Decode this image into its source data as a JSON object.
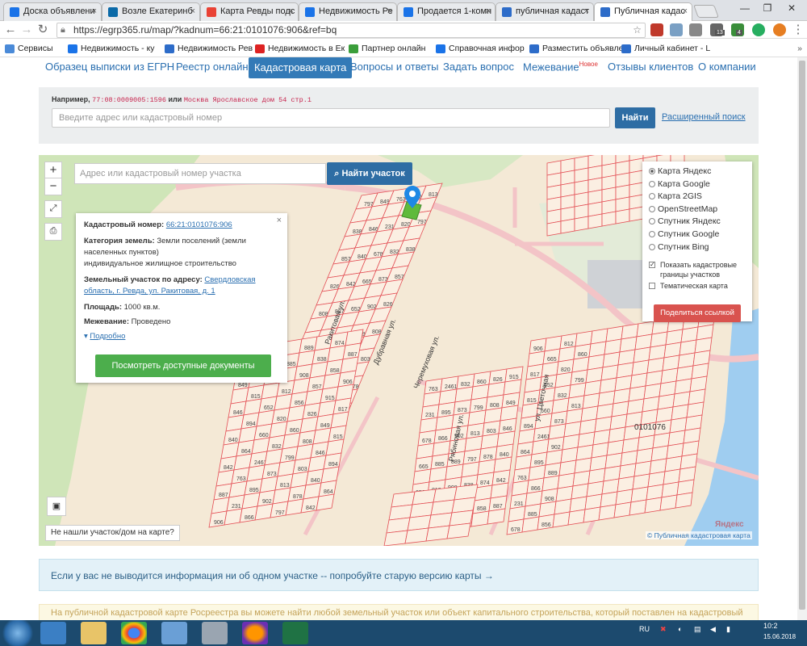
{
  "browser": {
    "tabs": [
      {
        "label": "Доска объявлени",
        "color": "#1a73e8"
      },
      {
        "label": "Возле Екатеринб",
        "color": "#0b6aa8"
      },
      {
        "label": "Карта Ревды подс",
        "color": "#e94235"
      },
      {
        "label": "Недвижимость Ре",
        "color": "#1a73e8"
      },
      {
        "label": "Продается 1-комн",
        "color": "#1a73e8"
      },
      {
        "label": "публичная кадаст",
        "color": "#2d6cc9"
      },
      {
        "label": "Публичная кадас",
        "color": "#2d6cc9"
      }
    ],
    "url": "https://egrp365.ru/map/?kadnum=66:21:0101076:906&ref=bq",
    "bookmarks": [
      "Сервисы",
      "Недвижимость - ку",
      "Недвижимость Рев",
      "Недвижимость в Ек",
      "Партнер онлайн",
      "Справочная инфор",
      "Разместить объявле",
      "Личный кабинет - L"
    ],
    "ext_badges": {
      "b1": "13",
      "b2": "4"
    }
  },
  "site_nav": {
    "items": [
      "Образец выписки из ЕГРН",
      "Реестр онлайн",
      "Кадастровая карта",
      "Вопросы и ответы",
      "Задать вопрос",
      "Межевание",
      "Отзывы клиентов",
      "О компании"
    ],
    "new_badge": "Новое"
  },
  "search": {
    "example_prefix": "Например,",
    "example_code1": "77:08:0009005:1596",
    "example_or": "или",
    "example_code2": "Москва Ярославское дом 54 стр.1",
    "placeholder": "Введите адрес или кадастровый номер",
    "button": "Найти",
    "advanced": "Расширенный поиск"
  },
  "map": {
    "zoom_in": "+",
    "zoom_out": "−",
    "search_placeholder": "Адрес или кадастровый номер участка",
    "search_button": "Найти участок",
    "info": {
      "cad_label": "Кадастровый номер:",
      "cad_value": "66:21:0101076:906",
      "category_label": "Категория земель:",
      "category_value": "Земли поселений (земли населенных пунктов)",
      "use_value": "индивидуальное жилищное строительство",
      "address_label": "Земельный участок по адресу:",
      "address_value": "Свердловская область, г. Ревда, ул. Ракитовая, д. 1",
      "area_label": "Площадь:",
      "area_value": "1000 кв.м.",
      "survey_label": "Межевание:",
      "survey_value": "Проведено",
      "more": "Подробно",
      "docs_button": "Посмотреть доступные документы",
      "close": "×"
    },
    "layers": [
      {
        "label": "Карта Яндекс",
        "selected": true
      },
      {
        "label": "Карта Google",
        "selected": false
      },
      {
        "label": "Карта 2GIS",
        "selected": false
      },
      {
        "label": "OpenStreetMap",
        "selected": false
      },
      {
        "label": "Спутник Яндекс",
        "selected": false
      },
      {
        "label": "Спутник Google",
        "selected": false
      },
      {
        "label": "Спутник Bing",
        "selected": false
      }
    ],
    "show_borders": "Показать кадастровые границы участков",
    "thematic": "Тематическая карта",
    "share": "Поделиться ссылкой",
    "not_found": "Не нашли участок/дом на карте?",
    "attribution": "© Публичная кадастровая карта",
    "yandex": "Яндекс",
    "street_labels": [
      "Ракитовая ул.",
      "Дубравная ул.",
      "Черемуховая ул.",
      "Рябиновая ул.",
      "ул. Цветочная"
    ],
    "block_label": "0101076",
    "plot_numbers": [
      "797",
      "838",
      "857",
      "826",
      "808",
      "803",
      "878",
      "874",
      "858",
      "915",
      "849",
      "846",
      "840",
      "842",
      "887",
      "906",
      "817",
      "815",
      "894",
      "864",
      "763",
      "231",
      "678",
      "665",
      "652",
      "660",
      "2461",
      "895",
      "866",
      "885",
      "812",
      "820",
      "832",
      "873",
      "902",
      "889",
      "908",
      "856",
      "860",
      "799",
      "813"
    ]
  },
  "notice": "Если у вас не выводится информация ни об одном участке -- попробуйте старую версию карты →",
  "notice2": "На публичной кадастровой карте Росреестра вы можете найти любой земельный участок или объект капитального строительства, который поставлен на кадастровый",
  "taskbar": {
    "lang": "RU",
    "time": "10:2",
    "date": "15.06.2018"
  }
}
